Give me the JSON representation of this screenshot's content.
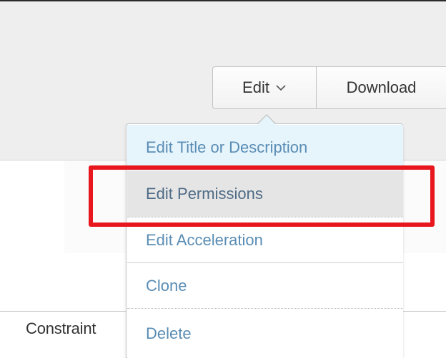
{
  "toolbar": {
    "edit_label": "Edit",
    "download_label": "Download",
    "edit_icon": "chevron-down-icon"
  },
  "edit_menu": {
    "items": [
      {
        "label": "Edit Title or Description"
      },
      {
        "label": "Edit Permissions"
      },
      {
        "label": "Edit Acceleration"
      },
      {
        "label": "Clone"
      },
      {
        "label": "Delete"
      }
    ]
  },
  "content": {
    "row_label": "Constraint"
  },
  "colors": {
    "highlight": "#e8161d",
    "menu_link": "#5a8db4",
    "menu_active_bg": "#e6f4fc",
    "menu_hover_bg": "#e5e5e5"
  }
}
